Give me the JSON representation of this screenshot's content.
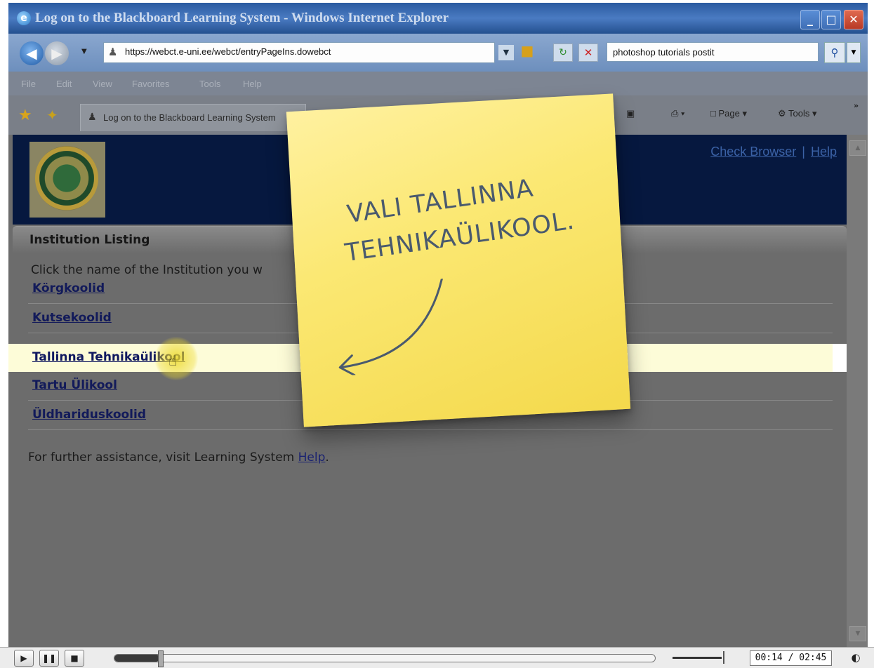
{
  "window": {
    "title": "Log on to the Blackboard Learning System - Windows Internet Explorer",
    "min_glyph": "_",
    "max_glyph": "□",
    "close_glyph": "✕"
  },
  "address_bar": {
    "url": "https://webct.e-uni.ee/webct/entryPageIns.dowebct",
    "search_value": "photoshop tutorials postit"
  },
  "menu": [
    "File",
    "Edit",
    "View",
    "Favorites",
    "Tools",
    "Help"
  ],
  "tab": {
    "label": "Log on to the Blackboard Learning System"
  },
  "commands": {
    "page": "Page",
    "tools": "Tools"
  },
  "header_links": {
    "check_browser": "Check Browser",
    "separator": "|",
    "help": "Help"
  },
  "listing": {
    "title": "Institution Listing",
    "instruction": "Click the name of the Institution you w",
    "institutions": [
      "Körgkoolid",
      "Kutsekoolid",
      "Tallinna Tehnikaülikool",
      "Tartu Ülikool",
      "Üldhariduskoolid"
    ],
    "highlighted_index": 2,
    "assist_prefix": "For further assistance, visit Learning System",
    "assist_link": "Help",
    "assist_suffix": "."
  },
  "sticky_note": {
    "line1": "VALI TALLINNA",
    "line2": "TEHNIKAÜLIKOOL.",
    "color": "#f8e160"
  },
  "player": {
    "time": "00:14 / 02:45",
    "progress_fraction": 0.085
  }
}
